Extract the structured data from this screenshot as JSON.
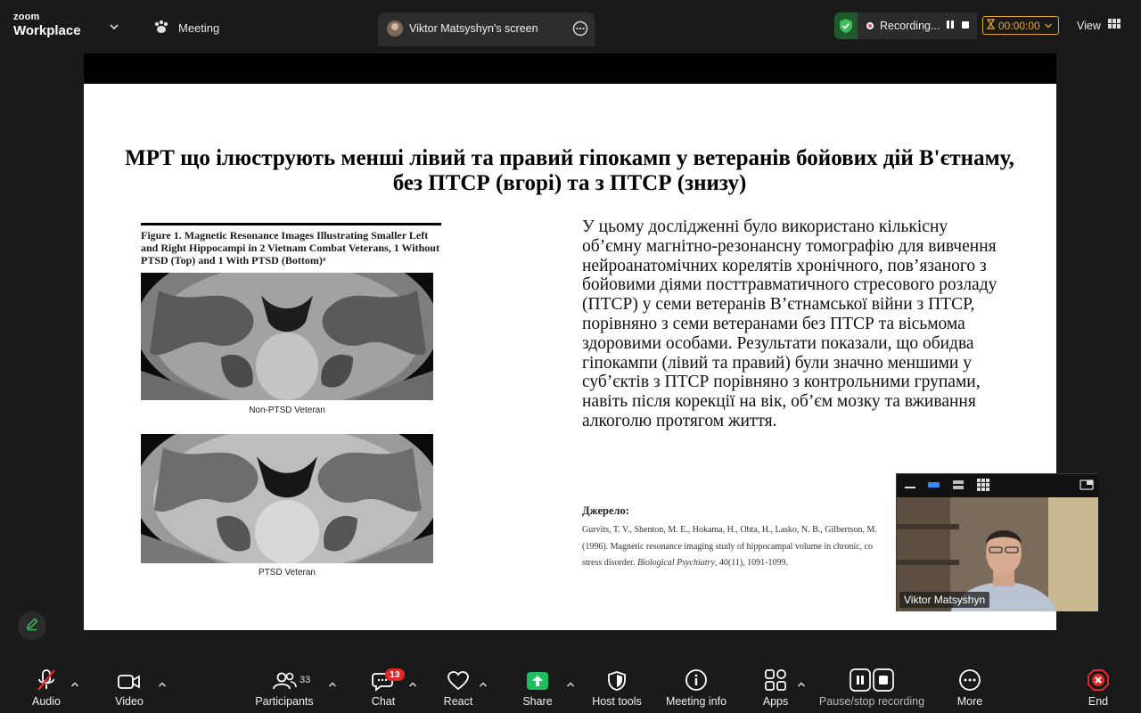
{
  "app": {
    "brand_top": "zoom",
    "brand_bottom": "Workplace",
    "meeting_label": "Meeting",
    "share_tab_label": "Viktor Matsyshyn's screen",
    "recording_label": "Recording...",
    "timer": "00:00:00",
    "view_label": "View",
    "colors": {
      "accent_timer": "#e8a723",
      "shield": "#3dbb5a",
      "share_green": "#1fbf5f",
      "end_red": "#e02828"
    }
  },
  "slide": {
    "title": "МРТ що ілюструють менші лівий та правий гіпокамп у  ветеранів бойових дій В'єтнаму, без ПТСР (вгорі) та з ПТСР (знизу)",
    "figure_caption": "Figure 1. Magnetic Resonance Images Illustrating Smaller Left and Right Hippocampi in 2 Vietnam Combat Veterans, 1 Without PTSD (Top) and 1 With PTSD (Bottom)ᵃ",
    "image1_label": "Non-PTSD Veteran",
    "image2_label": "PTSD Veteran",
    "body": "У цьому дослідженні було використано кількісну об’ємну магнітно-резонансну томографію для вивчення нейроанатомічних корелятів хронічного, пов’язаного з бойовими діями посттравматичного стресового розладу (ПТСР) у семи ветеранів В’єтнамської війни з ПТСР, порівняно з семи ветеранами без ПТСР та вісьмома здоровими особами. Результати показали, що обидва гіпокампи (лівий та правий) були значно меншими у суб’єктів з ПТСР порівняно з контрольними групами, навіть після корекції на вік, об’єм мозку та вживання алкоголю протягом життя.",
    "source_heading": "Джерело:",
    "source_line1": "Gurvits, T. V., Shenton, M. E., Hokama, H., Ohta, H., Lasko, N. B., Gilbertson, M.",
    "source_line2": "(1996). Magnetic resonance imaging study of hippocampal volume in chronic, co",
    "source_line3_pre": "stress disorder. ",
    "source_line3_journal": "Biological Psychiatry",
    "source_line3_post": ", 40(11), 1091-1099."
  },
  "video": {
    "participant_name": "Viktor Matsyshyn"
  },
  "toolbar": {
    "audio": "Audio",
    "video": "Video",
    "participants": "Participants",
    "participants_count": "33",
    "chat": "Chat",
    "chat_badge": "13",
    "react": "React",
    "share": "Share",
    "host_tools": "Host tools",
    "meeting_info": "Meeting info",
    "apps": "Apps",
    "pause_stop": "Pause/stop recording",
    "more": "More",
    "end": "End"
  }
}
